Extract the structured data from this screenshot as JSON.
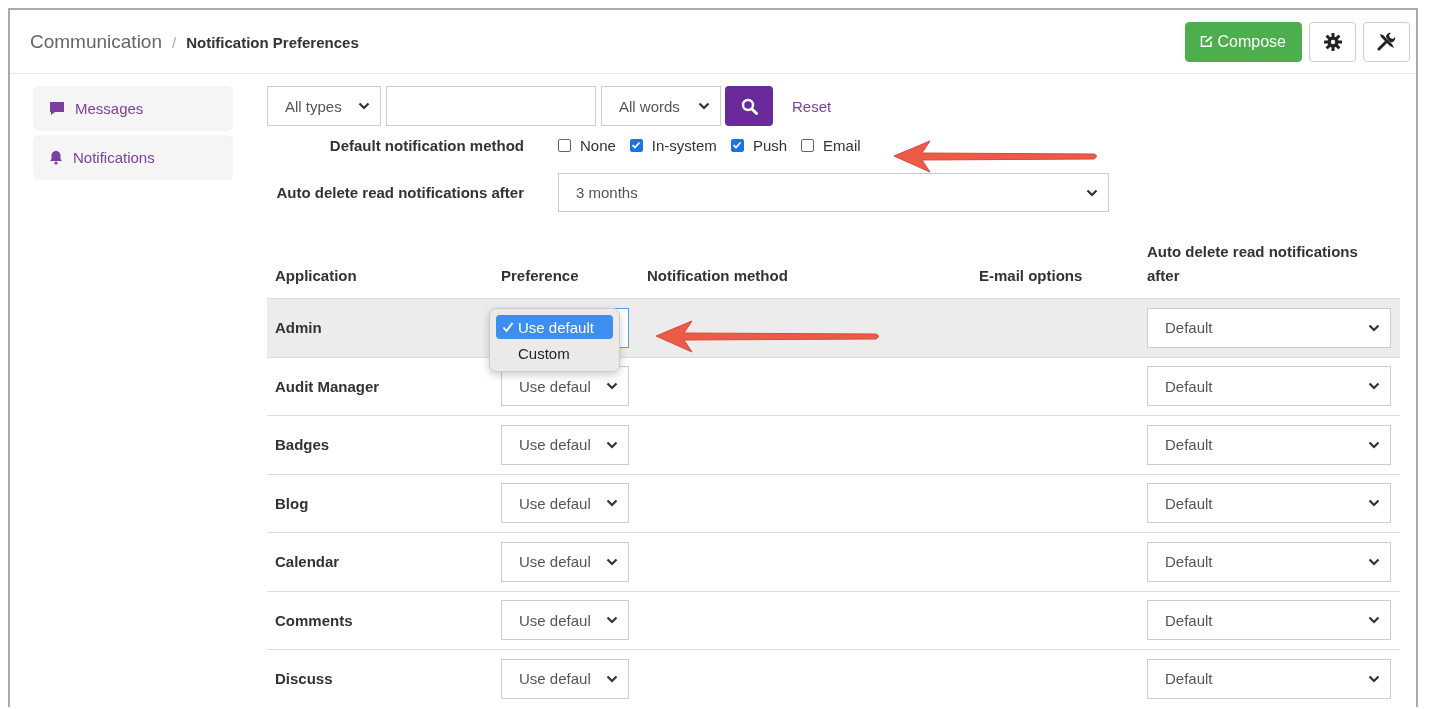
{
  "breadcrumb": {
    "items": [
      {
        "label": "Communication",
        "current": false
      },
      {
        "label": "Notification Preferences",
        "current": true
      }
    ],
    "separator": "/"
  },
  "header_buttons": [
    {
      "kind": "compose",
      "label": "Compose"
    },
    {
      "kind": "settings"
    },
    {
      "kind": "tools"
    }
  ],
  "sidebar": {
    "items": [
      {
        "kind": "chat",
        "label": "Messages"
      },
      {
        "kind": "bell",
        "label": "Notifications"
      }
    ]
  },
  "filters": {
    "type_select": "All types",
    "match_select": "All words",
    "reset": "Reset"
  },
  "default_method": {
    "label": "Default notification method",
    "options": [
      {
        "label": "None",
        "checked": false
      },
      {
        "label": "In-system",
        "checked": true
      },
      {
        "label": "Push",
        "checked": true
      },
      {
        "label": "Email",
        "checked": false
      }
    ]
  },
  "auto_delete": {
    "label": "Auto delete read notifications after",
    "value": "3 months"
  },
  "table": {
    "columns": [
      "Application",
      "Preference",
      "Notification method",
      "E-mail options",
      "Auto delete read notifications after"
    ],
    "rows": [
      {
        "application": "Admin",
        "selected": true,
        "preference_menu": {
          "options": [
            {
              "label": "Use default",
              "selected": true
            },
            {
              "label": "Custom",
              "selected": false
            }
          ]
        },
        "auto_delete": "Default"
      },
      {
        "application": "Audit Manager",
        "selected": false,
        "preference": "Use defaul",
        "auto_delete": "Default"
      },
      {
        "application": "Badges",
        "selected": false,
        "preference": "Use defaul",
        "auto_delete": "Default"
      },
      {
        "application": "Blog",
        "selected": false,
        "preference": "Use defaul",
        "auto_delete": "Default"
      },
      {
        "application": "Calendar",
        "selected": false,
        "preference": "Use defaul",
        "auto_delete": "Default"
      },
      {
        "application": "Comments",
        "selected": false,
        "preference": "Use defaul",
        "auto_delete": "Default"
      },
      {
        "application": "Discuss",
        "selected": false,
        "preference": "Use defaul",
        "auto_delete": "Default"
      }
    ]
  },
  "annotations": [
    {
      "kind": "arrow"
    },
    {
      "kind": "arrow"
    }
  ]
}
